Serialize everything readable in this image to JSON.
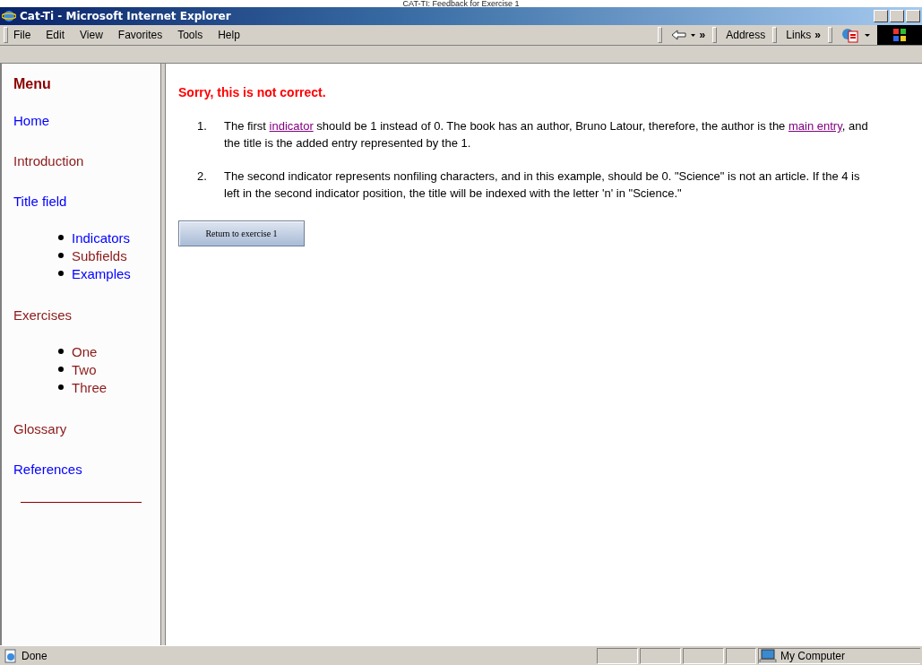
{
  "caption": "CAT-TI: Feedback for Exercise 1",
  "window": {
    "title": "Cat-Ti - Microsoft Internet Explorer"
  },
  "menu_bar": [
    "File",
    "Edit",
    "View",
    "Favorites",
    "Tools",
    "Help"
  ],
  "toolbar": {
    "address_label": "Address",
    "links_label": "Links",
    "chevron": "»"
  },
  "sidebar": {
    "heading": "Menu",
    "items": [
      {
        "label": "Home",
        "visited": false
      },
      {
        "label": "Introduction",
        "visited": true
      },
      {
        "label": "Title field",
        "visited": false,
        "children": [
          {
            "label": "Indicators",
            "visited": false
          },
          {
            "label": "Subfields",
            "visited": true
          },
          {
            "label": "Examples",
            "visited": false
          }
        ]
      },
      {
        "label": "Exercises",
        "visited": true,
        "children": [
          {
            "label": "One",
            "visited": true
          },
          {
            "label": "Two",
            "visited": true
          },
          {
            "label": "Three",
            "visited": true
          }
        ]
      },
      {
        "label": "Glossary",
        "visited": true
      },
      {
        "label": "References",
        "visited": false
      }
    ]
  },
  "content": {
    "heading": "Sorry, this is not correct.",
    "items": [
      {
        "number": "1.",
        "segments": [
          {
            "kind": "text",
            "text": "The first "
          },
          {
            "kind": "link",
            "text": "indicator"
          },
          {
            "kind": "text",
            "text": " should be 1 instead of 0. The book has an author, Bruno Latour, therefore, the author is the "
          },
          {
            "kind": "link",
            "text": "main entry"
          },
          {
            "kind": "text",
            "text": ", and the title is the added entry represented by the 1."
          }
        ]
      },
      {
        "number": "2.",
        "segments": [
          {
            "kind": "text",
            "text": "The second indicator represents nonfiling characters, and in this example, should be 0. \"Science\" is not an article. If the 4 is left in the second indicator position, the title will be indexed with the letter 'n' in \"Science.\""
          }
        ]
      }
    ],
    "button": "Return to exercise 1"
  },
  "status_bar": {
    "status": "Done",
    "zone": "My Computer"
  }
}
